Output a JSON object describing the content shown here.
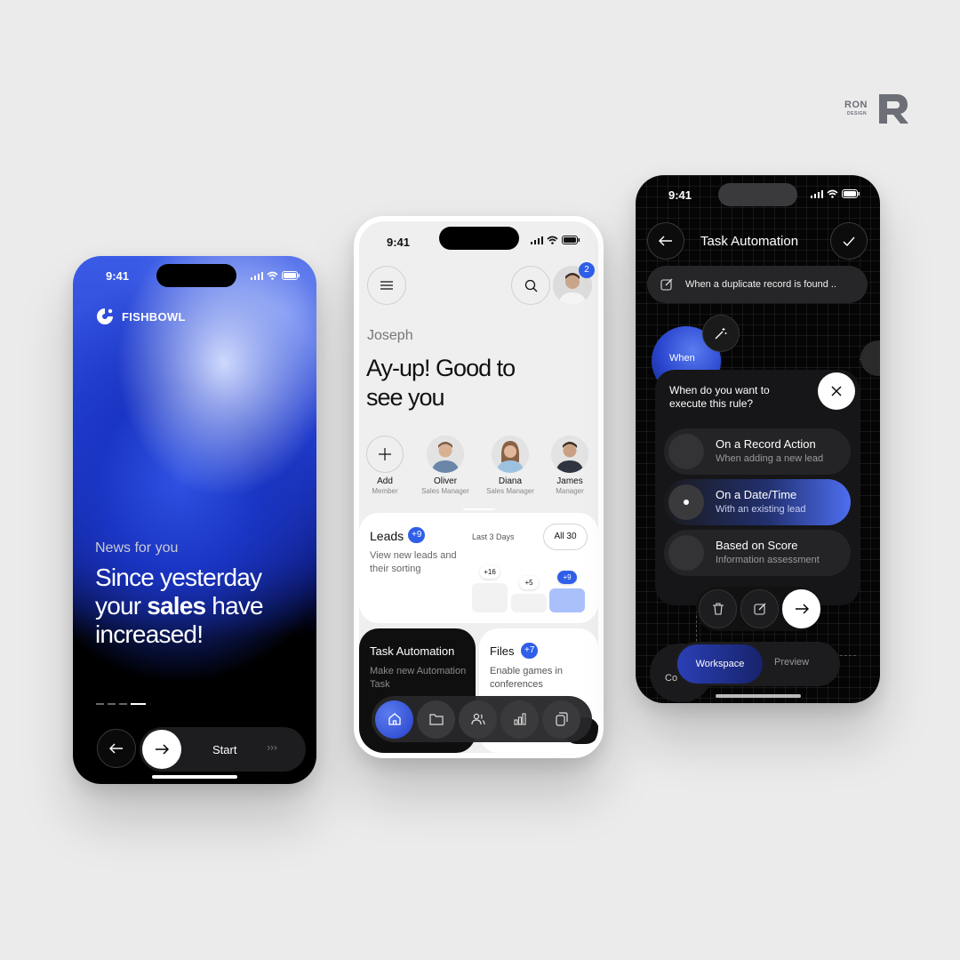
{
  "brand": {
    "name": "RON",
    "sub": "DESIGN"
  },
  "colors": {
    "accent": "#2f5fe8",
    "dark": "#0f0f0f",
    "light": "#efefef"
  },
  "phone1": {
    "time": "9:41",
    "app_name": "FISHBOWL",
    "news_label": "News for you",
    "headline_pre": "Since yesterday your ",
    "headline_bold": "sales",
    "headline_post": " have increased!",
    "start_label": "Start",
    "chevrons": "›››"
  },
  "phone2": {
    "time": "9:41",
    "profile_badge": "2",
    "user_name": "Joseph",
    "greeting": "Ay-up! Good to see you",
    "members": [
      {
        "name": "Add",
        "role": "Member"
      },
      {
        "name": "Oliver",
        "role": "Sales Manager"
      },
      {
        "name": "Diana",
        "role": "Sales Manager"
      },
      {
        "name": "James",
        "role": "Manager"
      }
    ],
    "leads": {
      "title": "Leads",
      "badge": "+9",
      "description": "View new leads and their sorting",
      "period": "Last 3 Days",
      "filter": "All 30",
      "bars": [
        {
          "label": "+16",
          "level": 0.55
        },
        {
          "label": "+5",
          "level": 0.35
        },
        {
          "label": "+9",
          "level": 0.45
        }
      ]
    },
    "task_card": {
      "title": "Task Automation",
      "description": "Make new Automation Task"
    },
    "files_card": {
      "title": "Files",
      "badge": "+7",
      "description": "Enable games in conferences"
    },
    "nav_icons": [
      "home-icon",
      "folder-icon",
      "users-icon",
      "chart-icon",
      "copy-icon"
    ]
  },
  "phone3": {
    "time": "9:41",
    "title": "Task Automation",
    "trigger": "When a duplicate record is found ..",
    "when_label": "When",
    "question": "When do you want to execute this rule?",
    "options": [
      {
        "title": "On a Record Action",
        "subtitle": "When adding a new lead",
        "selected": false
      },
      {
        "title": "On a Date/Time",
        "subtitle": "With an existing lead",
        "selected": true
      },
      {
        "title": "Based on Score",
        "subtitle": "Information assessment",
        "selected": false
      }
    ],
    "segments": {
      "active": "Workspace",
      "inactive": "Preview"
    },
    "bottom_left_text": "Co"
  }
}
